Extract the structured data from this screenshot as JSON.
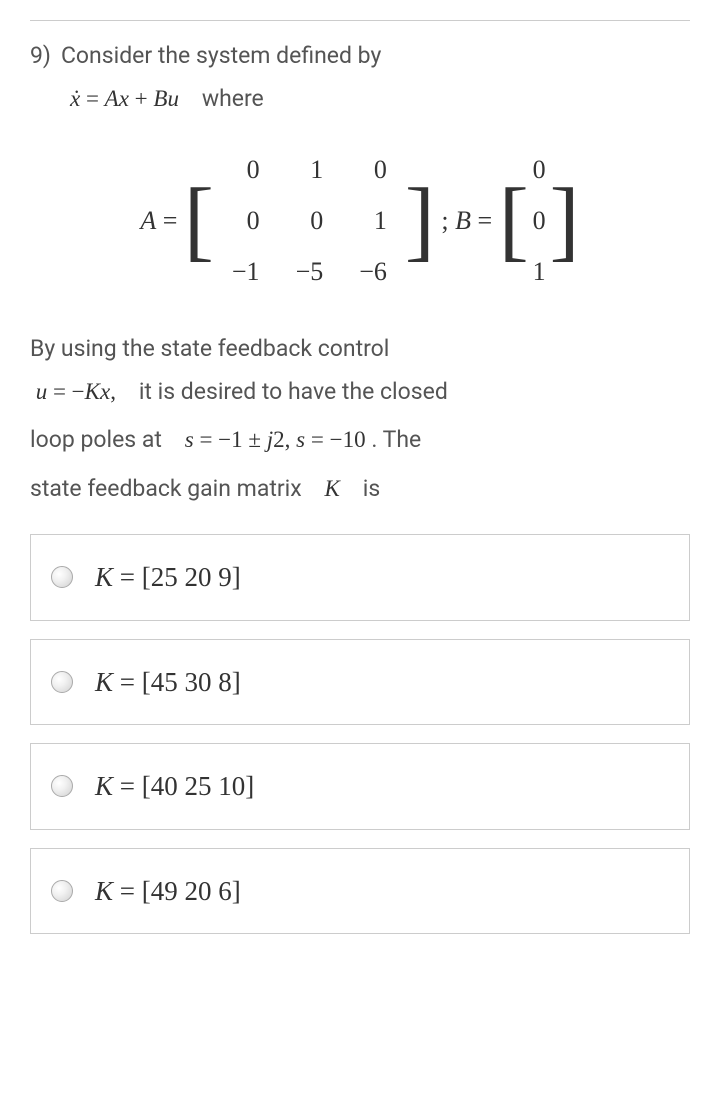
{
  "question": {
    "number": "9)",
    "prompt_line1": "Consider the system defined by",
    "where": "where",
    "matrixA": [
      [
        "0",
        "1",
        "0"
      ],
      [
        "0",
        "0",
        "1"
      ],
      [
        "−1",
        "−5",
        "−6"
      ]
    ],
    "matrixB": [
      "0",
      "0",
      "1"
    ],
    "body_line1_a": "By using the state feedback control",
    "body_line2_a": "it is desired to have the closed",
    "body_line3_a": "loop poles at",
    "body_line3_b": ". The",
    "body_line4_a": "state feedback gain matrix",
    "body_line4_b": "is"
  },
  "options": [
    {
      "values": "[25 20 9]"
    },
    {
      "values": "[45 30 8]"
    },
    {
      "values": "[40 25 10]"
    },
    {
      "values": "[49 20 6]"
    }
  ]
}
